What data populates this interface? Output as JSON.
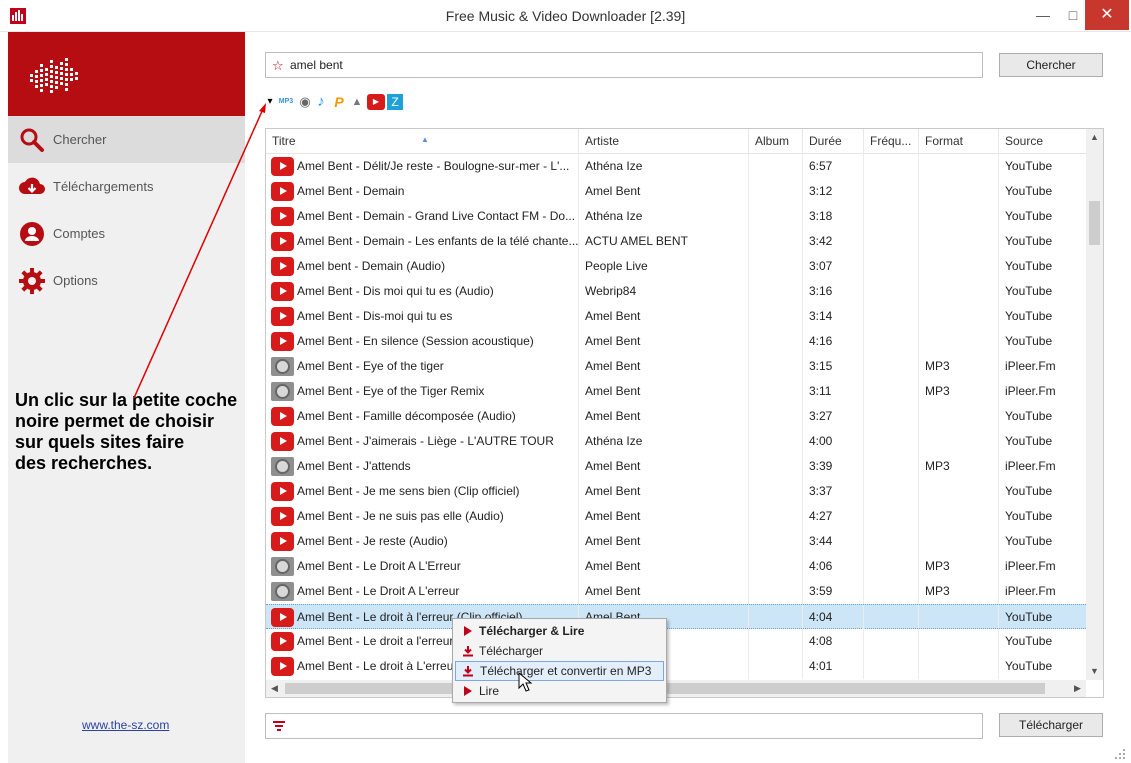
{
  "window": {
    "title": "Free Music & Video Downloader [2.39]",
    "minimize_glyph": "—",
    "maximize_glyph": "□",
    "close_glyph": "✕"
  },
  "colors": {
    "brand": "#b50d12",
    "youtube": "#d71a1a",
    "selection": "#cde6f7",
    "link": "#2a43a0"
  },
  "sidebar": {
    "items": [
      {
        "label": "Chercher",
        "icon": "search-icon",
        "active": true
      },
      {
        "label": "Téléchargements",
        "icon": "download-cloud-icon",
        "active": false
      },
      {
        "label": "Comptes",
        "icon": "user-icon",
        "active": false
      },
      {
        "label": "Options",
        "icon": "gear-icon",
        "active": false
      }
    ],
    "link": "www.the-sz.com"
  },
  "search": {
    "value": "amel bent",
    "button": "Chercher"
  },
  "sources": {
    "dropdown_glyph": "▾",
    "icons": [
      {
        "name": "mp3-icon",
        "glyph": "MP3"
      },
      {
        "name": "ipleer-icon",
        "glyph": "◉"
      },
      {
        "name": "music-note-icon",
        "glyph": "♪"
      },
      {
        "name": "p-icon",
        "glyph": "P"
      },
      {
        "name": "rocket-icon",
        "glyph": "▲"
      },
      {
        "name": "youtube-icon",
        "glyph": "▶"
      },
      {
        "name": "z-icon",
        "glyph": "Z"
      }
    ]
  },
  "table": {
    "columns": [
      "Titre",
      "Artiste",
      "Album",
      "Durée",
      "Fréqu...",
      "Format",
      "Source"
    ],
    "sort_glyph": "▲",
    "rows": [
      {
        "type": "youtube",
        "title": "Amel Bent - Délit/Je reste - Boulogne-sur-mer - L'...",
        "artist": "Athéna Ize",
        "album": "",
        "duration": "6:57",
        "freq": "",
        "format": "",
        "source": "YouTube"
      },
      {
        "type": "youtube",
        "title": "Amel Bent - Demain",
        "artist": "Amel Bent",
        "album": "",
        "duration": "3:12",
        "freq": "",
        "format": "",
        "source": "YouTube"
      },
      {
        "type": "youtube",
        "title": "Amel Bent - Demain - Grand Live Contact FM - Do...",
        "artist": "Athéna Ize",
        "album": "",
        "duration": "3:18",
        "freq": "",
        "format": "",
        "source": "YouTube"
      },
      {
        "type": "youtube",
        "title": "Amel Bent - Demain - Les enfants de la télé chante...",
        "artist": "ACTU AMEL BENT",
        "album": "",
        "duration": "3:42",
        "freq": "",
        "format": "",
        "source": "YouTube"
      },
      {
        "type": "youtube",
        "title": "Amel bent - Demain (Audio)",
        "artist": "People Live",
        "album": "",
        "duration": "3:07",
        "freq": "",
        "format": "",
        "source": "YouTube"
      },
      {
        "type": "youtube",
        "title": "Amel Bent - Dis moi qui tu es (Audio)",
        "artist": "Webrip84",
        "album": "",
        "duration": "3:16",
        "freq": "",
        "format": "",
        "source": "YouTube"
      },
      {
        "type": "youtube",
        "title": "Amel Bent - Dis-moi qui tu es",
        "artist": "Amel Bent",
        "album": "",
        "duration": "3:14",
        "freq": "",
        "format": "",
        "source": "YouTube"
      },
      {
        "type": "youtube",
        "title": "Amel Bent - En silence (Session acoustique)",
        "artist": "Amel Bent",
        "album": "",
        "duration": "4:16",
        "freq": "",
        "format": "",
        "source": "YouTube"
      },
      {
        "type": "ipleer",
        "title": "Amel Bent - Eye of the tiger",
        "artist": "Amel Bent",
        "album": "",
        "duration": "3:15",
        "freq": "",
        "format": "MP3",
        "source": "iPleer.Fm"
      },
      {
        "type": "ipleer",
        "title": "Amel Bent - Eye of the Tiger Remix",
        "artist": "Amel Bent",
        "album": "",
        "duration": "3:11",
        "freq": "",
        "format": "MP3",
        "source": "iPleer.Fm"
      },
      {
        "type": "youtube",
        "title": "Amel Bent - Famille décomposée (Audio)",
        "artist": "Amel Bent",
        "album": "",
        "duration": "3:27",
        "freq": "",
        "format": "",
        "source": "YouTube"
      },
      {
        "type": "youtube",
        "title": "Amel Bent - J'aimerais - Liège - L'AUTRE TOUR",
        "artist": "Athéna Ize",
        "album": "",
        "duration": "4:00",
        "freq": "",
        "format": "",
        "source": "YouTube"
      },
      {
        "type": "ipleer",
        "title": "Amel Bent - J'attends",
        "artist": "Amel Bent",
        "album": "",
        "duration": "3:39",
        "freq": "",
        "format": "MP3",
        "source": "iPleer.Fm"
      },
      {
        "type": "youtube",
        "title": "Amel Bent - Je me sens bien (Clip officiel)",
        "artist": "Amel Bent",
        "album": "",
        "duration": "3:37",
        "freq": "",
        "format": "",
        "source": "YouTube"
      },
      {
        "type": "youtube",
        "title": "Amel Bent - Je ne suis pas elle (Audio)",
        "artist": "Amel Bent",
        "album": "",
        "duration": "4:27",
        "freq": "",
        "format": "",
        "source": "YouTube"
      },
      {
        "type": "youtube",
        "title": "Amel Bent - Je reste (Audio)",
        "artist": "Amel Bent",
        "album": "",
        "duration": "3:44",
        "freq": "",
        "format": "",
        "source": "YouTube"
      },
      {
        "type": "ipleer",
        "title": "Amel Bent - Le Droit A L'Erreur",
        "artist": "Amel Bent",
        "album": "",
        "duration": "4:06",
        "freq": "",
        "format": "MP3",
        "source": "iPleer.Fm"
      },
      {
        "type": "ipleer",
        "title": "Amel Bent - Le Droit A L'erreur",
        "artist": "Amel Bent",
        "album": "",
        "duration": "3:59",
        "freq": "",
        "format": "MP3",
        "source": "iPleer.Fm"
      },
      {
        "type": "youtube",
        "title": "Amel Bent - Le droit à l'erreur (Clip officiel)",
        "artist": "Amel Bent",
        "album": "",
        "duration": "4:04",
        "freq": "",
        "format": "",
        "source": "YouTube",
        "selected": true
      },
      {
        "type": "youtube",
        "title": "Amel Bent - Le droit a l'erreur",
        "artist": "",
        "album": "",
        "duration": "4:08",
        "freq": "",
        "format": "",
        "source": "YouTube"
      },
      {
        "type": "youtube",
        "title": "Amel Bent - Le droit à L'erreur",
        "artist": "",
        "album": "",
        "duration": "4:01",
        "freq": "",
        "format": "",
        "source": "YouTube"
      }
    ]
  },
  "context_menu": {
    "items": [
      {
        "label": "Télécharger & Lire",
        "icon": "play-icon",
        "bold": true
      },
      {
        "label": "Télécharger",
        "icon": "download-icon",
        "bold": false
      },
      {
        "label": "Télécharger et convertir en MP3",
        "icon": "download-icon",
        "bold": false,
        "hover": true
      },
      {
        "label": "Lire",
        "icon": "play-icon",
        "bold": false
      }
    ]
  },
  "annotation": {
    "lines": [
      "Un clic sur la petite coche",
      "noire permet de choisir",
      "sur quels sites faire",
      "des recherches."
    ]
  },
  "bottom": {
    "filter_value": "",
    "download_button": "Télécharger"
  }
}
